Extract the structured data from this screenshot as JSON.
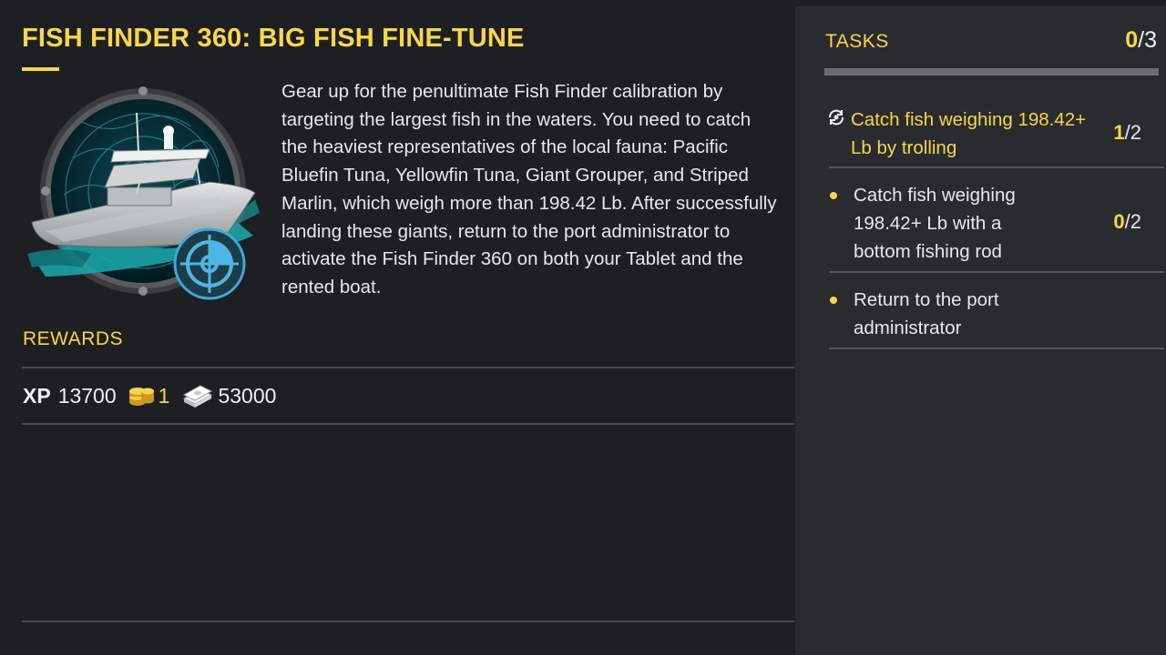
{
  "quest": {
    "title": "FISH FINDER 360: BIG FISH FINE-TUNE",
    "description": "Gear up for the penultimate Fish Finder calibration by targeting the largest fish in the waters. You need to catch the heaviest representatives of the local fauna: Pacific Bluefin Tuna, Yellowfin Tuna, Giant Grouper, and Striped Marlin, which weigh more than 198.42 Lb. After successfully landing these giants, return to the port administrator to activate the Fish Finder 360 on both your Tablet and the rented boat."
  },
  "rewards": {
    "heading": "REWARDS",
    "xp_label": "XP",
    "xp_value": "13700",
    "coins_value": "1",
    "cash_value": "53000",
    "icons": [
      "coins-icon",
      "cash-icon"
    ]
  },
  "tasks": {
    "heading": "TASKS",
    "completed": "0",
    "total": "/3",
    "items": [
      {
        "text": "Catch fish weighing 198.42+ Lb by trolling",
        "done": "1",
        "total": "/2",
        "active": true,
        "icon": "in-progress-icon"
      },
      {
        "text": "Catch fish weighing 198.42+ Lb with a bottom fishing rod",
        "done": "0",
        "total": "/2",
        "active": false,
        "icon": "bullet-dot"
      },
      {
        "text": "Return to the port administrator",
        "done": "",
        "total": "",
        "active": false,
        "icon": "bullet-dot"
      }
    ]
  },
  "colors": {
    "accent": "#f7d64a",
    "background": "#1e1f22",
    "panel": "#2a2b2e",
    "emblem_glow": "#27c5c8"
  }
}
